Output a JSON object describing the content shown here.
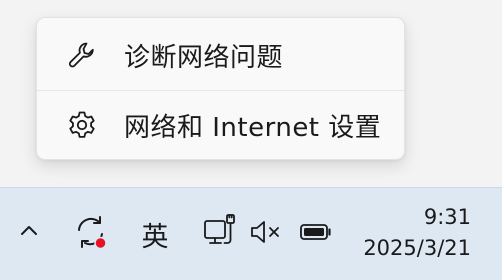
{
  "context_menu": {
    "items": [
      {
        "label": "诊断网络问题",
        "icon": "wrench-icon"
      },
      {
        "label": "网络和 Internet 设置",
        "icon": "gear-icon"
      }
    ]
  },
  "taskbar": {
    "tray": {
      "show_hidden_icon": "chevron-up-icon",
      "sync_icon": "sync-icon",
      "sync_badge_color": "#e81123",
      "ime_label": "英",
      "network_icon": "network-ethernet-icon",
      "volume_icon": "volume-muted-icon",
      "battery_icon": "battery-icon"
    },
    "clock": {
      "time": "9:31",
      "date": "2025/3/21"
    }
  },
  "colors": {
    "taskbar_bg": "#dde8f3",
    "menu_bg": "#f9f9f9",
    "text": "#1a1a1a"
  }
}
